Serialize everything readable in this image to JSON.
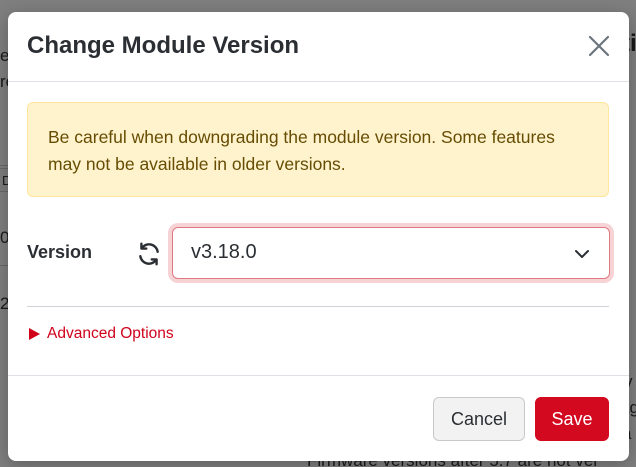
{
  "background": {
    "fragments": [
      "ti",
      "e",
      "ro",
      "D",
      "0",
      "2",
      "ag",
      "a",
      "v",
      "Firmware versions after 5.7 are not ver"
    ]
  },
  "modal": {
    "title": "Change Module Version",
    "close_icon": "close-icon",
    "alert": {
      "text": "Be careful when downgrading the module version. Some features may not be available in older versions."
    },
    "version": {
      "label": "Version",
      "refresh_icon": "refresh-icon",
      "selected": "v3.18.0",
      "dropdown_icon": "chevron-down-icon"
    },
    "advanced": {
      "label": "Advanced Options",
      "icon": "caret-right-icon"
    },
    "footer": {
      "cancel_label": "Cancel",
      "save_label": "Save"
    }
  },
  "colors": {
    "alert_bg": "#fff3cd",
    "alert_text": "#664d03",
    "accent_red": "#d3091f",
    "focus_ring": "#e07a82"
  }
}
